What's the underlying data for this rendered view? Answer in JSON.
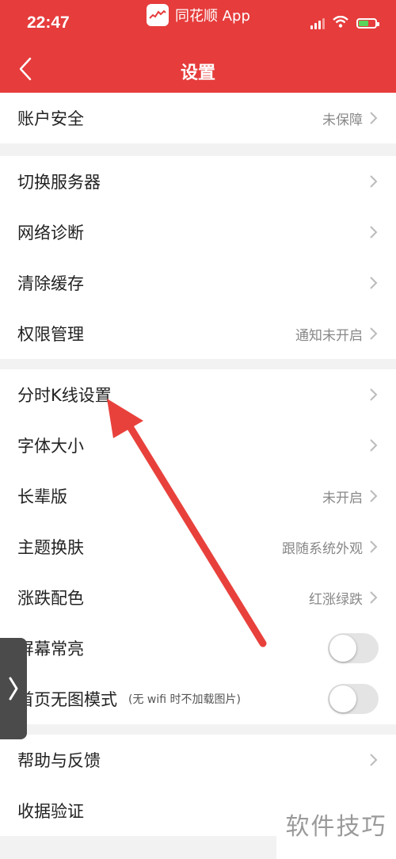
{
  "status_bar": {
    "time": "22:47",
    "app_name": "同花顺 App",
    "battery_level": 0.6
  },
  "header": {
    "title": "设置"
  },
  "groups": [
    {
      "items": [
        {
          "label": "账户安全",
          "value": "未保障"
        }
      ]
    },
    {
      "items": [
        {
          "label": "切换服务器",
          "value": ""
        },
        {
          "label": "网络诊断",
          "value": ""
        },
        {
          "label": "清除缓存",
          "value": ""
        },
        {
          "label": "权限管理",
          "value": "通知未开启"
        }
      ]
    },
    {
      "items": [
        {
          "label": "分时K线设置",
          "value": ""
        },
        {
          "label": "字体大小",
          "value": ""
        },
        {
          "label": "长辈版",
          "value": "未开启"
        },
        {
          "label": "主题换肤",
          "value": "跟随系统外观"
        },
        {
          "label": "涨跌配色",
          "value": "红涨绿跌"
        },
        {
          "label": "屏幕常亮",
          "toggle": false
        },
        {
          "label": "首页无图模式",
          "note": "(无 wifi 时不加载图片)",
          "toggle": false
        }
      ]
    },
    {
      "items": [
        {
          "label": "帮助与反馈",
          "value": ""
        },
        {
          "label": "收据验证",
          "value": ""
        }
      ]
    }
  ],
  "watermark": "软件技巧",
  "colors": {
    "brand": "#e63c3c",
    "arrow": "#e8413c"
  }
}
